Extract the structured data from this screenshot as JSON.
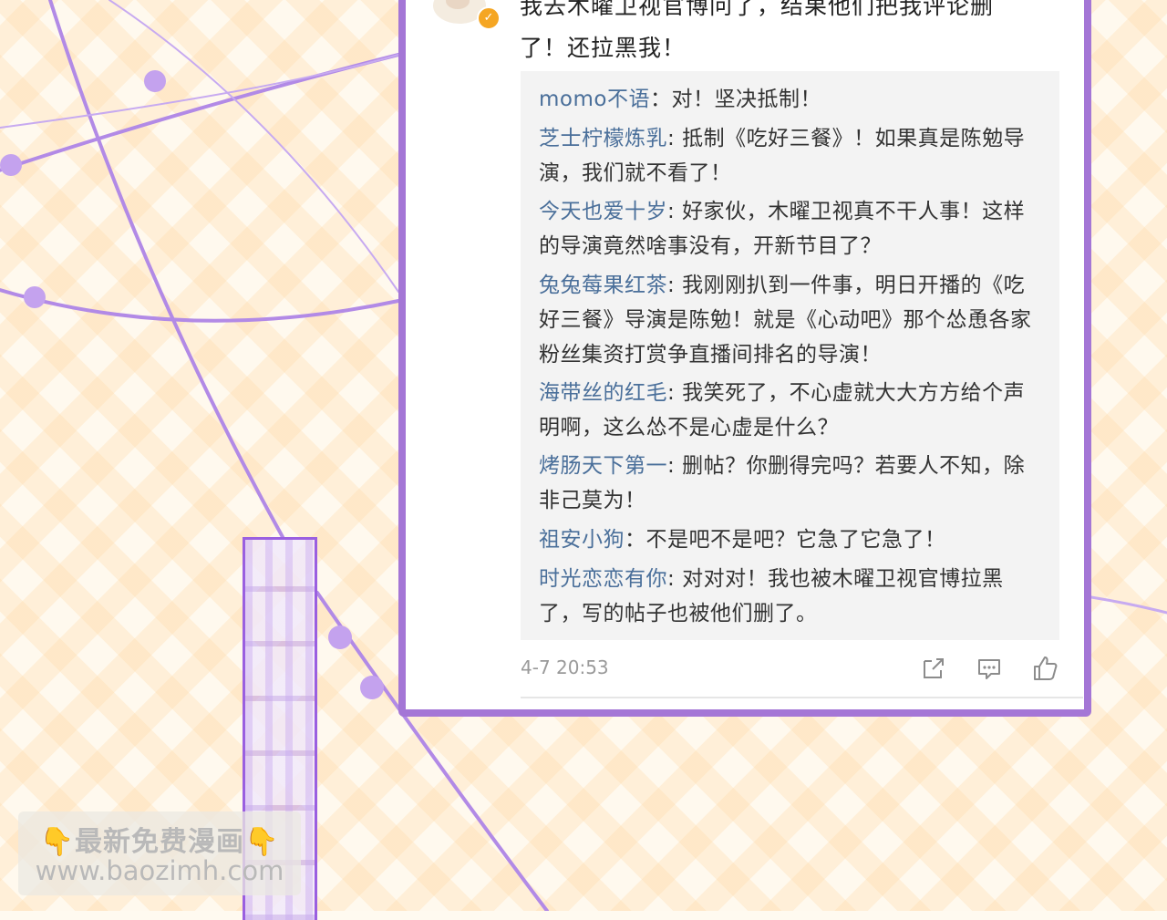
{
  "post": {
    "text": "我去木曜卫视官博问了，结果他们把我评论删了！还拉黑我！"
  },
  "replies": [
    {
      "user": "momo不语",
      "sep": "：",
      "text": "对！坚决抵制！"
    },
    {
      "user": "芝士柠檬炼乳",
      "sep": ": ",
      "text": "抵制《吃好三餐》！如果真是陈勉导演，我们就不看了！"
    },
    {
      "user": "今天也爱十岁",
      "sep": ": ",
      "text": "好家伙，木曜卫视真不干人事！这样的导演竟然啥事没有，开新节目了？"
    },
    {
      "user": "兔兔莓果红茶",
      "sep": ": ",
      "text": "我刚刚扒到一件事，明日开播的《吃好三餐》导演是陈勉！就是《心动吧》那个怂恿各家粉丝集资打赏争直播间排名的导演！"
    },
    {
      "user": "海带丝的红毛",
      "sep": ": ",
      "text": "我笑死了，不心虚就大大方方给个声明啊，这么怂不是心虚是什么？"
    },
    {
      "user": "烤肠天下第一",
      "sep": ": ",
      "text": "删帖？你删得完吗？若要人不知，除非己莫为！"
    },
    {
      "user": "祖安小狗",
      "sep": "：",
      "text": "不是吧不是吧？它急了它急了！"
    },
    {
      "user": "时光恋恋有你",
      "sep": ": ",
      "text": "对对对！我也被木曜卫视官博拉黑了，写的帖子也被他们删了。"
    }
  ],
  "meta": {
    "time": "4-7 20:53"
  },
  "actions": {
    "share_icon": "share-icon",
    "comment_icon": "comment-icon",
    "like_icon": "thumbs-up-icon"
  },
  "watermark": {
    "line1": "👇最新免费漫画👇",
    "line2": "www.baozimh.com"
  },
  "colors": {
    "frame": "#a476d6",
    "username": "#4a6f9a",
    "reply_bg": "#f3f3f3",
    "verified": "#f5a623"
  }
}
